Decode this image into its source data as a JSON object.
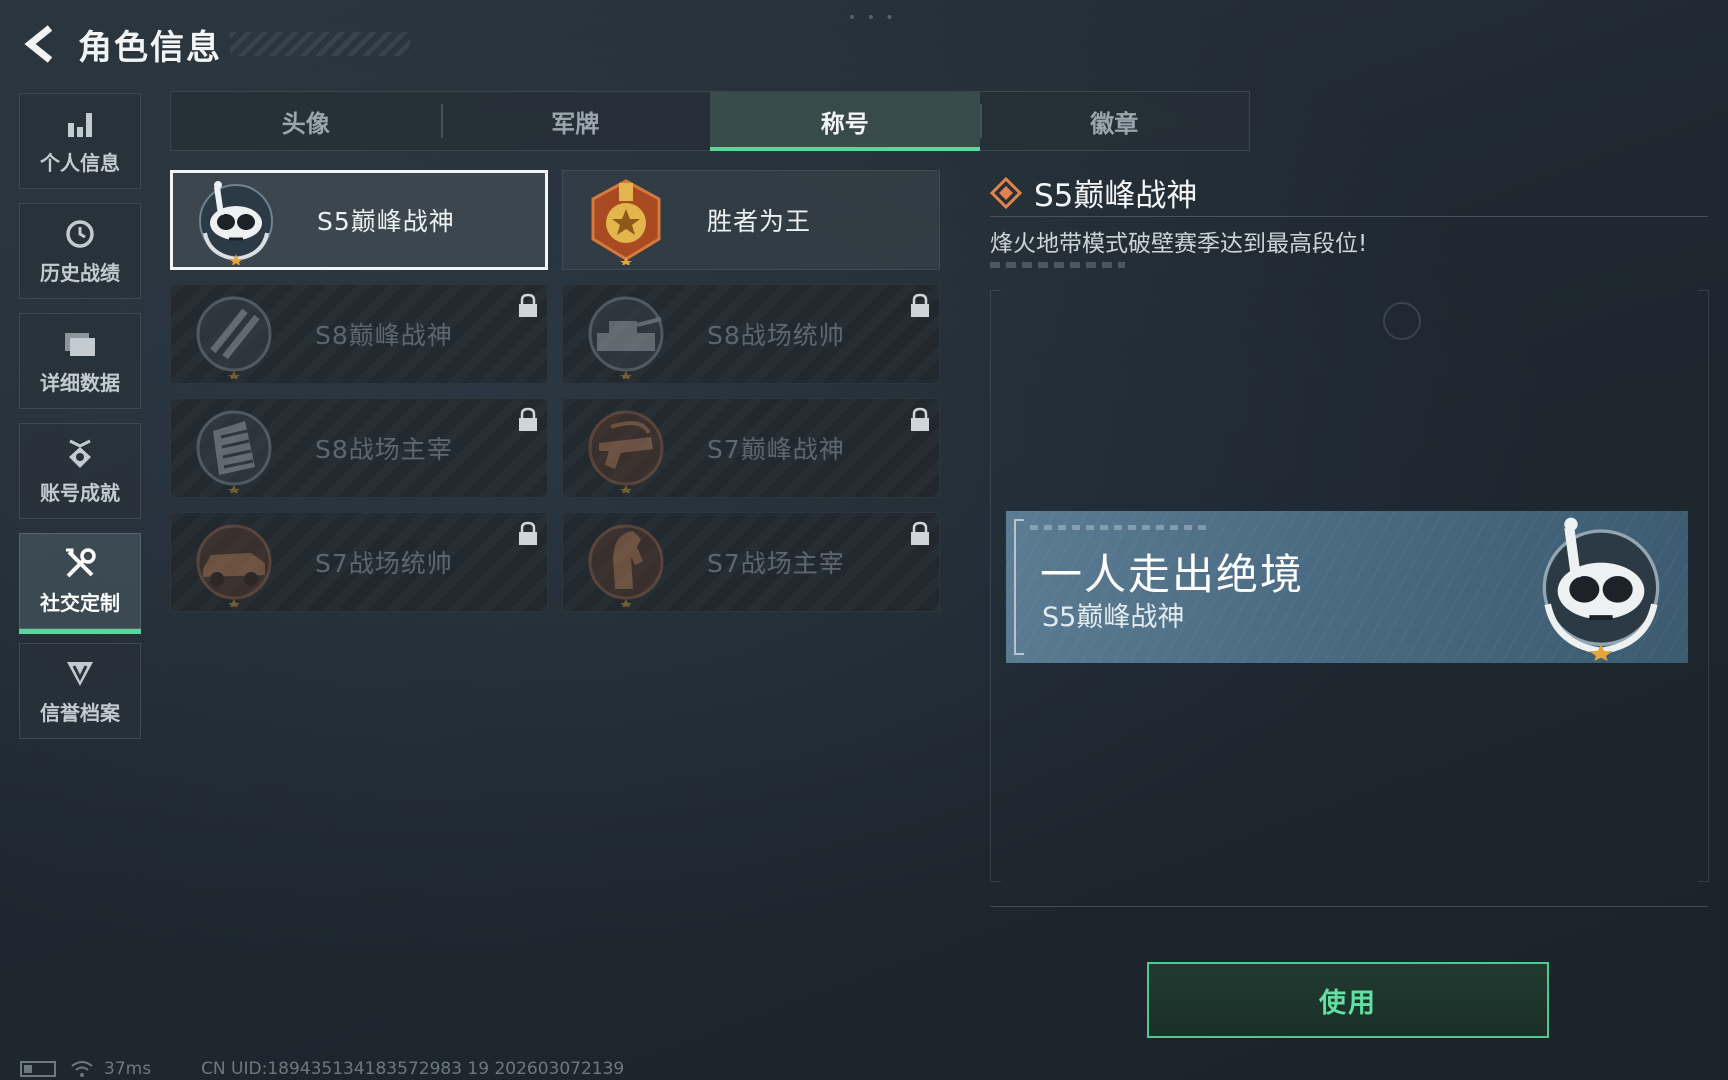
{
  "header": {
    "title": "角色信息"
  },
  "sidebar": {
    "items": [
      {
        "label": "个人信息",
        "icon": "bar-chart-icon",
        "active": false
      },
      {
        "label": "历史战绩",
        "icon": "history-icon",
        "active": false
      },
      {
        "label": "详细数据",
        "icon": "folder-icon",
        "active": false
      },
      {
        "label": "账号成就",
        "icon": "achievement-icon",
        "active": false
      },
      {
        "label": "社交定制",
        "icon": "tools-icon",
        "active": true
      },
      {
        "label": "信誉档案",
        "icon": "shield-icon",
        "active": false
      }
    ]
  },
  "tabs": [
    {
      "label": "头像",
      "active": false
    },
    {
      "label": "军牌",
      "active": false
    },
    {
      "label": "称号",
      "active": true
    },
    {
      "label": "徽章",
      "active": false
    }
  ],
  "titles": [
    {
      "name": "S5巅峰战神",
      "icon": "diver-mask-emblem-icon",
      "locked": false,
      "selected": true
    },
    {
      "name": "胜者为王",
      "icon": "gold-medal-emblem-icon",
      "locked": false,
      "selected": false
    },
    {
      "name": "S8巅峰战神",
      "icon": "slash-emblem-icon",
      "locked": true,
      "selected": false
    },
    {
      "name": "S8战场统帅",
      "icon": "tank-emblem-icon",
      "locked": true,
      "selected": false
    },
    {
      "name": "S8战场主宰",
      "icon": "building-emblem-icon",
      "locked": true,
      "selected": false
    },
    {
      "name": "S7巅峰战神",
      "icon": "gun-emblem-icon",
      "locked": true,
      "selected": false
    },
    {
      "name": "S7战场统帅",
      "icon": "vehicle-emblem-icon",
      "locked": true,
      "selected": false
    },
    {
      "name": "S7战场主宰",
      "icon": "horse-emblem-icon",
      "locked": true,
      "selected": false
    }
  ],
  "detail": {
    "title": "S5巅峰战神",
    "description": "烽火地带模式破壁赛季达到最高段位!"
  },
  "preview": {
    "main_text": "一人走出绝境",
    "sub_text": "S5巅峰战神"
  },
  "use_button": {
    "label": "使用"
  },
  "footer": {
    "ping": "37ms",
    "uid": "CN UID:189435134183572983 19 202603072139"
  },
  "colors": {
    "accent_green": "#5ed39a",
    "detail_icon_orange": "#e3824c",
    "preview_blue": "#4a6b82"
  }
}
